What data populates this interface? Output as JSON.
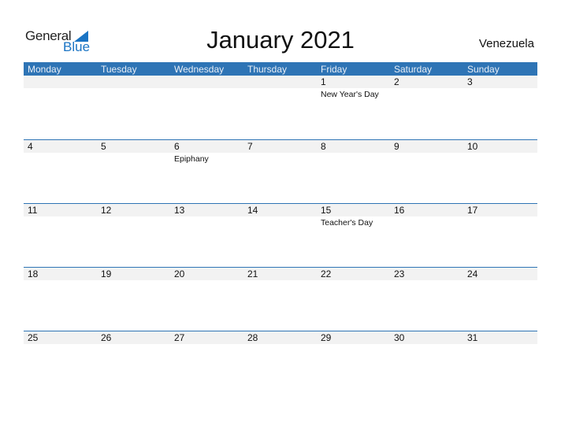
{
  "logo": {
    "word1": "General",
    "word2": "Blue",
    "brand_color": "#1a74c4"
  },
  "title": "January 2021",
  "country": "Venezuela",
  "header_color": "#2e74b5",
  "days": [
    "Monday",
    "Tuesday",
    "Wednesday",
    "Thursday",
    "Friday",
    "Saturday",
    "Sunday"
  ],
  "weeks": [
    {
      "dates": [
        "",
        "",
        "",
        "",
        "1",
        "2",
        "3"
      ],
      "holidays": [
        "",
        "",
        "",
        "",
        "New Year's Day",
        "",
        ""
      ]
    },
    {
      "dates": [
        "4",
        "5",
        "6",
        "7",
        "8",
        "9",
        "10"
      ],
      "holidays": [
        "",
        "",
        "Epiphany",
        "",
        "",
        "",
        ""
      ]
    },
    {
      "dates": [
        "11",
        "12",
        "13",
        "14",
        "15",
        "16",
        "17"
      ],
      "holidays": [
        "",
        "",
        "",
        "",
        "Teacher's Day",
        "",
        ""
      ]
    },
    {
      "dates": [
        "18",
        "19",
        "20",
        "21",
        "22",
        "23",
        "24"
      ],
      "holidays": [
        "",
        "",
        "",
        "",
        "",
        "",
        ""
      ]
    },
    {
      "dates": [
        "25",
        "26",
        "27",
        "28",
        "29",
        "30",
        "31"
      ],
      "holidays": [
        "",
        "",
        "",
        "",
        "",
        "",
        ""
      ]
    }
  ]
}
